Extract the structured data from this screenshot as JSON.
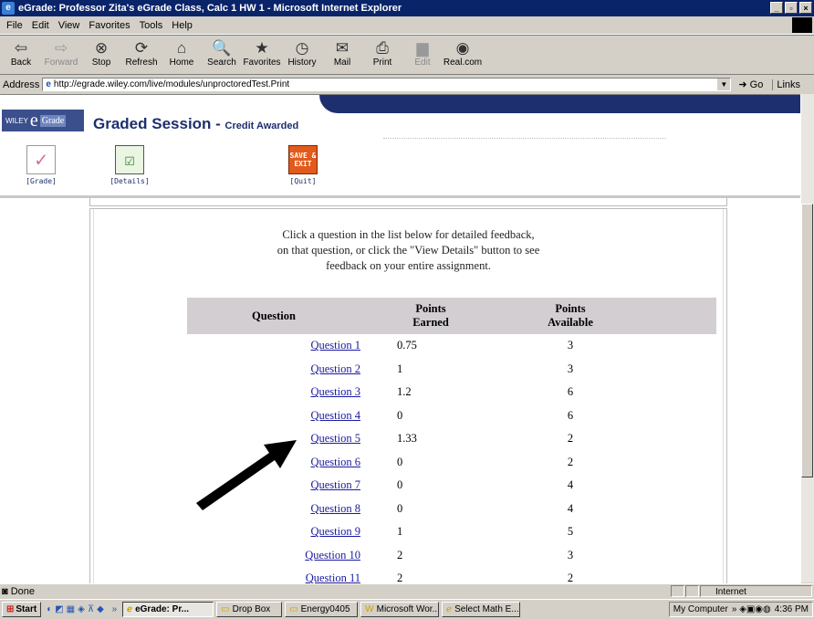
{
  "window": {
    "title": "eGrade: Professor Zita's eGrade Class, Calc 1 HW 1 - Microsoft Internet Explorer"
  },
  "menu": [
    "File",
    "Edit",
    "View",
    "Favorites",
    "Tools",
    "Help"
  ],
  "toolbar": [
    {
      "label": "Back",
      "icon": "back-arrow-icon",
      "glyph": "⇦",
      "enabled": true
    },
    {
      "label": "Forward",
      "icon": "forward-arrow-icon",
      "glyph": "⇨",
      "enabled": false
    },
    {
      "label": "Stop",
      "icon": "stop-icon",
      "glyph": "⊗",
      "enabled": true
    },
    {
      "label": "Refresh",
      "icon": "refresh-icon",
      "glyph": "⟳",
      "enabled": true
    },
    {
      "label": "Home",
      "icon": "home-icon",
      "glyph": "⌂",
      "enabled": true
    },
    {
      "label": "Search",
      "icon": "search-icon",
      "glyph": "🔍",
      "enabled": true
    },
    {
      "label": "Favorites",
      "icon": "favorites-icon",
      "glyph": "★",
      "enabled": true
    },
    {
      "label": "History",
      "icon": "history-icon",
      "glyph": "◷",
      "enabled": true
    },
    {
      "label": "Mail",
      "icon": "mail-icon",
      "glyph": "✉",
      "enabled": true
    },
    {
      "label": "Print",
      "icon": "print-icon",
      "glyph": "⎙",
      "enabled": true
    },
    {
      "label": "Edit",
      "icon": "edit-icon",
      "glyph": "▆",
      "enabled": false
    },
    {
      "label": "Real.com",
      "icon": "real-icon",
      "glyph": "◉",
      "enabled": true
    }
  ],
  "address": {
    "label": "Address",
    "url": "http://egrade.wiley.com/live/modules/unproctoredTest.Print",
    "go": "Go",
    "links": "Links"
  },
  "page": {
    "logo": {
      "publisher": "WILEY",
      "e": "e",
      "grade": "Grade"
    },
    "title": "Graded Session",
    "subtitle": "Credit Awarded",
    "nav": {
      "grade": "[Grade]",
      "details": "[Details]",
      "quit": "[Quit]",
      "quit_icon_text": "SAVE & EXIT"
    },
    "instructions": [
      "Click a question in the list below for detailed feedback,",
      "on that question, or click the \"View Details\" button to see",
      "feedback on your entire assignment."
    ],
    "table": {
      "headers": [
        "Question",
        "Points Earned",
        "Points Available"
      ],
      "rows": [
        {
          "question": "Question 1",
          "earned": "0.75",
          "available": "3"
        },
        {
          "question": "Question 2",
          "earned": "1",
          "available": "3"
        },
        {
          "question": "Question 3",
          "earned": "1.2",
          "available": "6"
        },
        {
          "question": "Question 4",
          "earned": "0",
          "available": "6"
        },
        {
          "question": "Question 5",
          "earned": "1.33",
          "available": "2"
        },
        {
          "question": "Question 6",
          "earned": "0",
          "available": "2"
        },
        {
          "question": "Question 7",
          "earned": "0",
          "available": "4"
        },
        {
          "question": "Question 8",
          "earned": "0",
          "available": "4"
        },
        {
          "question": "Question 9",
          "earned": "1",
          "available": "5"
        },
        {
          "question": "Question 10",
          "earned": "2",
          "available": "3"
        },
        {
          "question": "Question 11",
          "earned": "2",
          "available": "2"
        }
      ]
    }
  },
  "status": {
    "text": "Done",
    "zone": "Internet"
  },
  "taskbar": {
    "start": "Start",
    "buttons": [
      "eGrade: Pr...",
      "Drop Box",
      "Energy0405",
      "Microsoft Wor...",
      "Select Math E..."
    ],
    "tray_label": "My Computer",
    "time": "4:36 PM"
  },
  "colors": {
    "title_bar": "#0a246a",
    "header_band": "#1d2f6e",
    "table_header": "#d3ced2",
    "link": "#1a1aa0"
  }
}
